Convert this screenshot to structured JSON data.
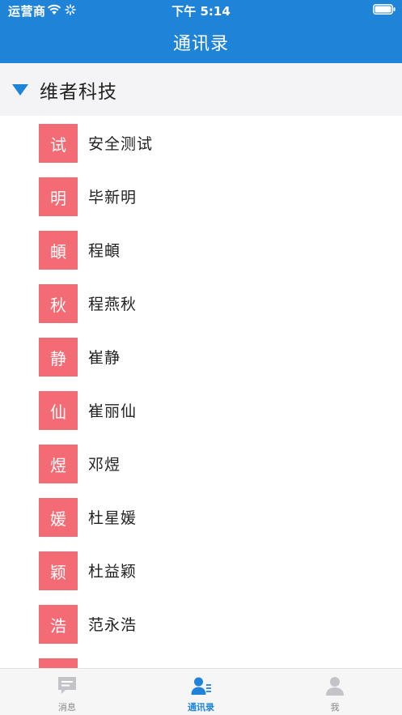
{
  "status_bar": {
    "carrier": "运营商",
    "time": "下午 5:14"
  },
  "header": {
    "title": "通讯录"
  },
  "group": {
    "name": "维者科技",
    "expanded": true
  },
  "contacts": [
    {
      "avatar": "试",
      "name": "安全测试"
    },
    {
      "avatar": "明",
      "name": "毕新明"
    },
    {
      "avatar": "頔",
      "name": "程頔"
    },
    {
      "avatar": "秋",
      "name": "程燕秋"
    },
    {
      "avatar": "静",
      "name": "崔静"
    },
    {
      "avatar": "仙",
      "name": "崔丽仙"
    },
    {
      "avatar": "煜",
      "name": "邓煜"
    },
    {
      "avatar": "媛",
      "name": "杜星媛"
    },
    {
      "avatar": "颖",
      "name": "杜益颖"
    },
    {
      "avatar": "浩",
      "name": "范永浩"
    },
    {
      "avatar": "",
      "name": ""
    }
  ],
  "tabbar": {
    "tabs": [
      {
        "label": "消息",
        "icon": "message-icon",
        "active": false
      },
      {
        "label": "通讯录",
        "icon": "contacts-icon",
        "active": true
      },
      {
        "label": "我",
        "icon": "profile-icon",
        "active": false
      }
    ]
  },
  "colors": {
    "brand_blue": "#1f84d8",
    "avatar_red": "#f36b75",
    "tab_inactive": "#c3c3c8"
  }
}
